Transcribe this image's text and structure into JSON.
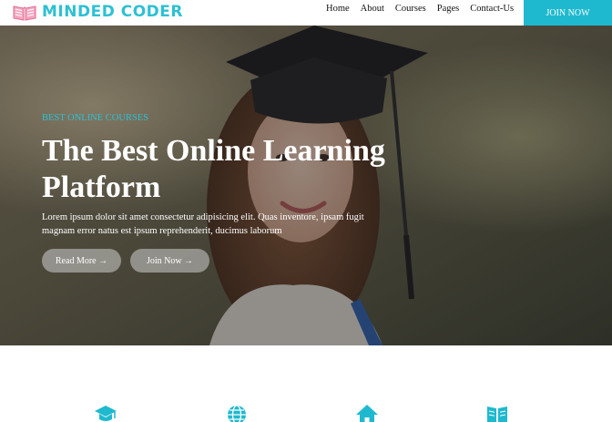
{
  "brand": {
    "name": "MINDED CODER",
    "logo_icon": "open-book-icon",
    "accent": "#2ec0d3"
  },
  "nav": {
    "links": [
      "Home",
      "About",
      "Courses",
      "Pages",
      "Contact-Us"
    ],
    "cta": "JOIN NOW"
  },
  "hero": {
    "eyebrow": "BEST ONLINE COURSES",
    "title": "The Best Online Learning Platform",
    "description": "Lorem ipsum dolor sit amet consectetur adipisicing elit. Quas inventore, ipsam fugit magnam error natus est ipsum reprehenderit, ducimus laborum",
    "buttons": {
      "read_more": "Read More →",
      "join_now": "Join Now →"
    },
    "background_subject": "graduate-student-photo"
  },
  "features": {
    "icons": [
      "graduation-cap-icon",
      "globe-icon",
      "home-icon",
      "book-icon"
    ],
    "icon_color": "#1fb9cf"
  }
}
